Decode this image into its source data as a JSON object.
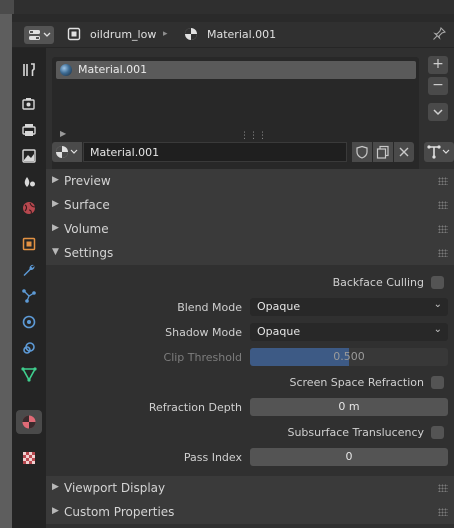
{
  "header": {
    "object_name": "oildrum_low",
    "material_name": "Material.001"
  },
  "slots": {
    "items": [
      {
        "label": "Material.001"
      }
    ],
    "add_label": "+",
    "remove_label": "−",
    "specials_label": "⌄"
  },
  "material_field": {
    "value": "Material.001"
  },
  "panels": {
    "preview": "Preview",
    "surface": "Surface",
    "volume": "Volume",
    "settings": "Settings",
    "viewport_display": "Viewport Display",
    "custom_properties": "Custom Properties"
  },
  "settings": {
    "backface_culling": {
      "label": "Backface Culling",
      "checked": false
    },
    "blend_mode": {
      "label": "Blend Mode",
      "value": "Opaque"
    },
    "shadow_mode": {
      "label": "Shadow Mode",
      "value": "Opaque"
    },
    "clip_threshold": {
      "label": "Clip Threshold",
      "value": "0.500",
      "fraction": 0.5
    },
    "screen_space_refraction": {
      "label": "Screen Space Refraction",
      "checked": false
    },
    "refraction_depth": {
      "label": "Refraction Depth",
      "value": "0 m"
    },
    "subsurface_translucency": {
      "label": "Subsurface Translucency",
      "checked": false
    },
    "pass_index": {
      "label": "Pass Index",
      "value": "0"
    }
  },
  "colors": {
    "accent_blue": "#3d5a85",
    "panel_header": "#3a3a3a",
    "background": "#303030"
  }
}
